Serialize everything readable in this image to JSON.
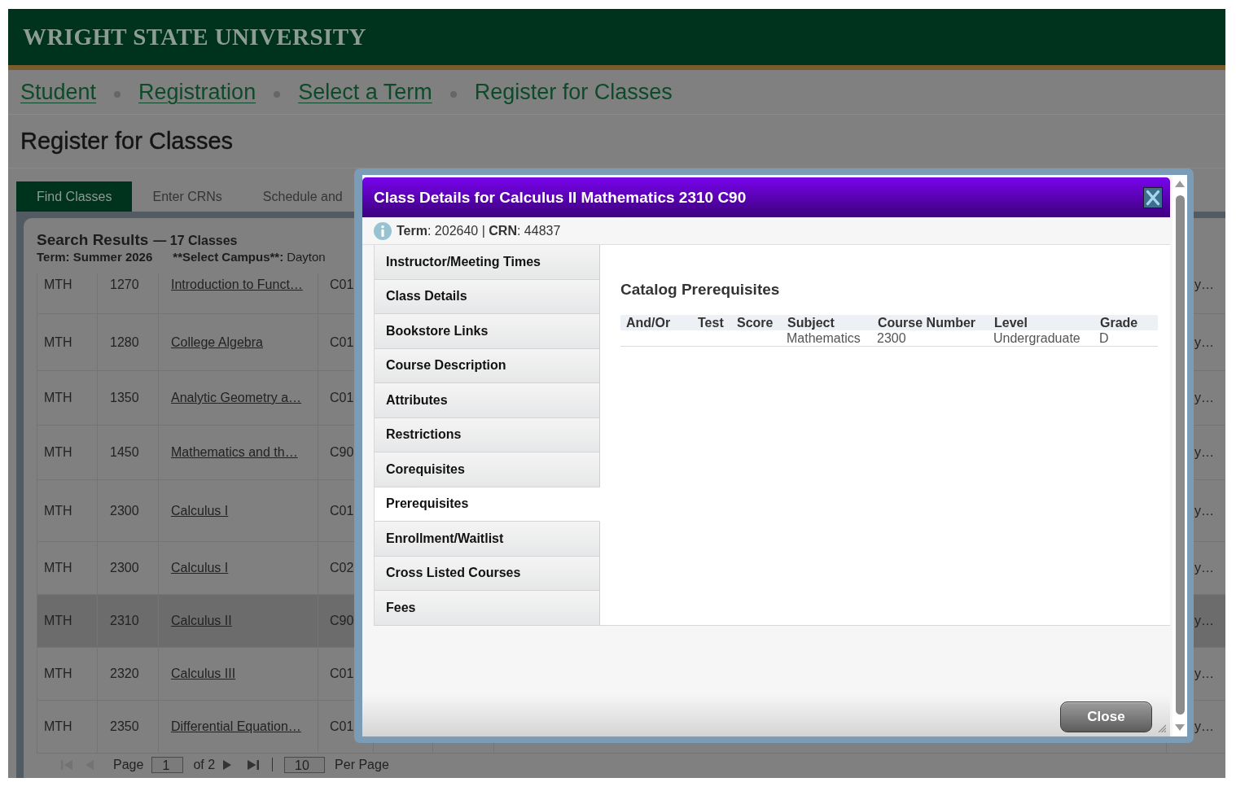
{
  "header": {
    "logo": "WRIGHT STATE UNIVERSITY"
  },
  "breadcrumb": [
    {
      "label": "Student",
      "link": true
    },
    {
      "label": "Registration",
      "link": true
    },
    {
      "label": "Select a Term",
      "link": true
    },
    {
      "label": "Register for Classes",
      "link": false
    }
  ],
  "page_title": "Register for Classes",
  "tabs": [
    {
      "label": "Find Classes",
      "selected": true
    },
    {
      "label": "Enter CRNs",
      "selected": false
    },
    {
      "label": "Schedule and",
      "selected": false
    }
  ],
  "results": {
    "title": "Search Results",
    "count": "— 17 Classes",
    "term": "Term: Summer 2026",
    "campus_label": "**Select Campus**:",
    "campus_value": "Dayton",
    "rows": [
      {
        "subject": "MTH",
        "course_number": "1270",
        "title": "Introduction to Funct…",
        "section": "C01",
        "column_8": "y…",
        "selected": false
      },
      {
        "subject": "MTH",
        "course_number": "1280",
        "title": "College Algebra",
        "section": "C01",
        "column_8": "y…",
        "selected": false
      },
      {
        "subject": "MTH",
        "course_number": "1350",
        "title": "Analytic Geometry a…",
        "section": "C01",
        "column_8": "y…",
        "selected": false
      },
      {
        "subject": "MTH",
        "course_number": "1450",
        "title": "Mathematics and th…",
        "section": "C90",
        "column_8": "y…",
        "selected": false
      },
      {
        "subject": "MTH",
        "course_number": "2300",
        "title": "Calculus I",
        "section": "C01",
        "column_8": "y…",
        "selected": false
      },
      {
        "subject": "MTH",
        "course_number": "2300",
        "title": "Calculus I",
        "section": "C02",
        "column_8": "y…",
        "selected": false
      },
      {
        "subject": "MTH",
        "course_number": "2310",
        "title": "Calculus II",
        "section": "C90",
        "column_8": "y…",
        "selected": true
      },
      {
        "subject": "MTH",
        "course_number": "2320",
        "title": "Calculus III",
        "section": "C01",
        "column_8": "y…",
        "selected": false
      },
      {
        "subject": "MTH",
        "course_number": "2350",
        "title": "Differential Equation…",
        "section": "C01",
        "column_8": "y…",
        "selected": false
      }
    ]
  },
  "pagination": {
    "nav_buttons": [
      {
        "kind": "first",
        "disabled": true
      },
      {
        "kind": "previous",
        "disabled": true
      },
      {
        "kind": "next",
        "disabled": false
      },
      {
        "kind": "last",
        "disabled": false
      }
    ],
    "page_label": "Page",
    "page_value": "1",
    "page_total": "of 2",
    "per_page_value": "10",
    "per_page_label": "Per Page"
  },
  "dialog": {
    "title": "Class Details for Calculus II Mathematics 2310 C90",
    "info": "**Term**: 202640 | **CRN**: 44837",
    "nav_items": [
      {
        "label": "Instructor/Meeting Times",
        "selected": false
      },
      {
        "label": "Class Details",
        "selected": false
      },
      {
        "label": "Bookstore Links",
        "selected": false
      },
      {
        "label": "Course Description",
        "selected": false
      },
      {
        "label": "Attributes",
        "selected": false
      },
      {
        "label": "Restrictions",
        "selected": false
      },
      {
        "label": "Corequisites",
        "selected": false
      },
      {
        "label": "Prerequisites",
        "selected": true
      },
      {
        "label": "Enrollment/Waitlist",
        "selected": false
      },
      {
        "label": "Cross Listed Courses",
        "selected": false
      },
      {
        "label": "Fees",
        "selected": false
      }
    ],
    "content": {
      "heading": "Catalog Prerequisites",
      "table": {
        "columns": [
          "And/Or",
          "Test",
          "Score",
          "Subject",
          "Course Number",
          "Level",
          "Grade"
        ],
        "rows": [
          {
            "subject": "Mathematics",
            "course_number": "2300",
            "level": "Undergraduate",
            "grade": "D"
          }
        ]
      }
    },
    "close_button": "Close"
  }
}
